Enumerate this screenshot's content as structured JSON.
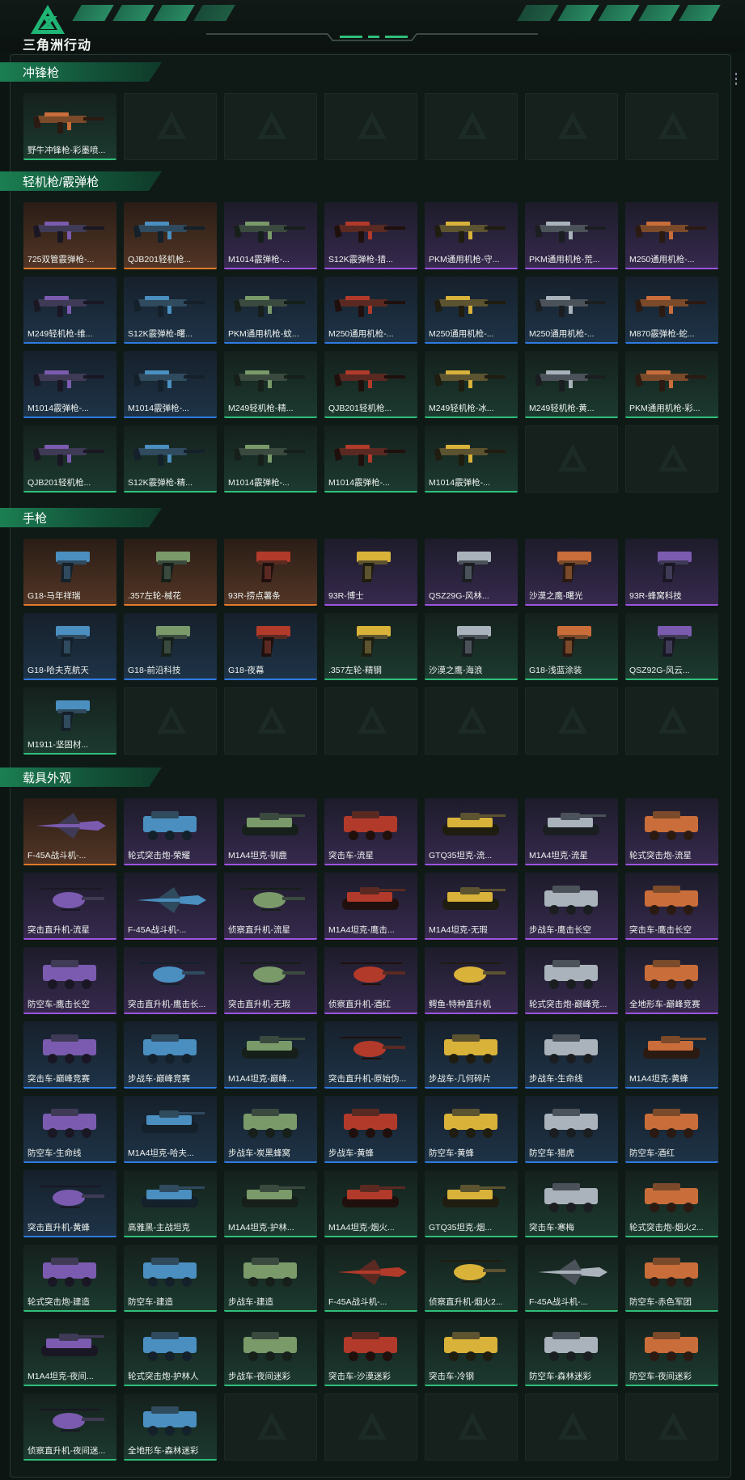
{
  "app": {
    "title": "三角洲行动"
  },
  "colors": {
    "orange": "#e27a2a",
    "purple": "#9c54e0",
    "blue": "#2f7ae0",
    "green": "#2fbf7a",
    "accent": "#1b7f52"
  },
  "sections": [
    {
      "title": "冲锋枪",
      "icon": "gun-icon",
      "slots": 7,
      "items": [
        {
          "name": "野牛冲锋枪-彩墨喷...",
          "rarity": "green"
        }
      ]
    },
    {
      "title": "轻机枪/霰弹枪",
      "icon": "gun-icon",
      "slots": 28,
      "items": [
        {
          "name": "725双管霰弹枪-...",
          "rarity": "orange"
        },
        {
          "name": "QJB201轻机枪...",
          "rarity": "orange"
        },
        {
          "name": "M1014霰弹枪-...",
          "rarity": "purple"
        },
        {
          "name": "S12K霰弹枪-猎...",
          "rarity": "purple"
        },
        {
          "name": "PKM通用机枪-守...",
          "rarity": "purple"
        },
        {
          "name": "PKM通用机枪-荒...",
          "rarity": "purple"
        },
        {
          "name": "M250通用机枪-...",
          "rarity": "purple"
        },
        {
          "name": "M249轻机枪-维...",
          "rarity": "blue"
        },
        {
          "name": "S12K霰弹枪-曙...",
          "rarity": "blue"
        },
        {
          "name": "PKM通用机枪-蚊...",
          "rarity": "blue"
        },
        {
          "name": "M250通用机枪-...",
          "rarity": "blue"
        },
        {
          "name": "M250通用机枪-...",
          "rarity": "blue"
        },
        {
          "name": "M250通用机枪-...",
          "rarity": "blue"
        },
        {
          "name": "M870霰弹枪-蛇...",
          "rarity": "blue"
        },
        {
          "name": "M1014霰弹枪-...",
          "rarity": "blue"
        },
        {
          "name": "M1014霰弹枪-...",
          "rarity": "blue"
        },
        {
          "name": "M249轻机枪-精...",
          "rarity": "green"
        },
        {
          "name": "QJB201轻机枪...",
          "rarity": "green"
        },
        {
          "name": "M249轻机枪-冰...",
          "rarity": "green"
        },
        {
          "name": "M249轻机枪-黄...",
          "rarity": "green"
        },
        {
          "name": "PKM通用机枪-彩...",
          "rarity": "green"
        },
        {
          "name": "QJB201轻机枪...",
          "rarity": "green"
        },
        {
          "name": "S12K霰弹枪-精...",
          "rarity": "green"
        },
        {
          "name": "M1014霰弹枪-...",
          "rarity": "green"
        },
        {
          "name": "M1014霰弹枪-...",
          "rarity": "green"
        },
        {
          "name": "M1014霰弹枪-...",
          "rarity": "green"
        }
      ]
    },
    {
      "title": "手枪",
      "icon": "pistol-icon",
      "slots": 21,
      "items": [
        {
          "name": "G18-马年祥瑞",
          "rarity": "orange"
        },
        {
          "name": ".357左轮-械花",
          "rarity": "orange"
        },
        {
          "name": "93R-捞点薯条",
          "rarity": "orange"
        },
        {
          "name": "93R-博士",
          "rarity": "purple"
        },
        {
          "name": "QSZ29G-风林...",
          "rarity": "purple"
        },
        {
          "name": "沙漠之鹰-曙光",
          "rarity": "purple"
        },
        {
          "name": "93R-蜂窝科技",
          "rarity": "purple"
        },
        {
          "name": "G18-哈夫克航天",
          "rarity": "blue"
        },
        {
          "name": "G18-前沿科技",
          "rarity": "blue"
        },
        {
          "name": "G18-夜幕",
          "rarity": "blue"
        },
        {
          "name": ".357左轮-精钢",
          "rarity": "green"
        },
        {
          "name": "沙漠之鹰-海浪",
          "rarity": "green"
        },
        {
          "name": "G18-浅蓝涂装",
          "rarity": "green"
        },
        {
          "name": "QSZ92G-风云...",
          "rarity": "green"
        },
        {
          "name": "M1911-坚固材...",
          "rarity": "green"
        }
      ]
    },
    {
      "title": "载具外观",
      "icon": "vehicle-icon",
      "slots": 63,
      "items": [
        {
          "name": "F-45A战斗机-...",
          "rarity": "orange"
        },
        {
          "name": "轮式突击炮-荣耀",
          "rarity": "purple"
        },
        {
          "name": "M1A4坦克-驯鹿",
          "rarity": "purple"
        },
        {
          "name": "突击车-流星",
          "rarity": "purple"
        },
        {
          "name": "GTQ35坦克-流...",
          "rarity": "purple"
        },
        {
          "name": "M1A4坦克-流星",
          "rarity": "purple"
        },
        {
          "name": "轮式突击炮-流星",
          "rarity": "purple"
        },
        {
          "name": "突击直升机-流星",
          "rarity": "purple"
        },
        {
          "name": "F-45A战斗机-...",
          "rarity": "purple"
        },
        {
          "name": "侦察直升机-流星",
          "rarity": "purple"
        },
        {
          "name": "M1A4坦克-鹰击...",
          "rarity": "purple"
        },
        {
          "name": "M1A4坦克-无瑕",
          "rarity": "purple"
        },
        {
          "name": "步战车-鹰击长空",
          "rarity": "purple"
        },
        {
          "name": "突击车-鹰击长空",
          "rarity": "purple"
        },
        {
          "name": "防空车-鹰击长空",
          "rarity": "purple"
        },
        {
          "name": "突击直升机-鹰击长...",
          "rarity": "purple"
        },
        {
          "name": "突击直升机-无瑕",
          "rarity": "purple"
        },
        {
          "name": "侦察直升机-酒红",
          "rarity": "purple"
        },
        {
          "name": "鳄鱼-特种直升机",
          "rarity": "purple"
        },
        {
          "name": "轮式突击炮-巅峰竞...",
          "rarity": "purple"
        },
        {
          "name": "全地形车-巅峰竞赛",
          "rarity": "purple"
        },
        {
          "name": "突击车-巅峰竞赛",
          "rarity": "blue"
        },
        {
          "name": "步战车-巅峰竞赛",
          "rarity": "blue"
        },
        {
          "name": "M1A4坦克-巅峰...",
          "rarity": "blue"
        },
        {
          "name": "突击直升机-原始伪...",
          "rarity": "blue"
        },
        {
          "name": "步战车-几何碎片",
          "rarity": "blue"
        },
        {
          "name": "步战车-生命线",
          "rarity": "blue"
        },
        {
          "name": "M1A4坦克-黄蜂",
          "rarity": "blue"
        },
        {
          "name": "防空车-生命线",
          "rarity": "blue"
        },
        {
          "name": "M1A4坦克-哈夫...",
          "rarity": "blue"
        },
        {
          "name": "步战车-炭黑蜂窝",
          "rarity": "blue"
        },
        {
          "name": "步战车-黄蜂",
          "rarity": "blue"
        },
        {
          "name": "防空车-黄蜂",
          "rarity": "blue"
        },
        {
          "name": "防空车-猎虎",
          "rarity": "blue"
        },
        {
          "name": "防空车-酒红",
          "rarity": "blue"
        },
        {
          "name": "突击直升机-黄蜂",
          "rarity": "blue"
        },
        {
          "name": "高雅黑-主战坦克",
          "rarity": "green"
        },
        {
          "name": "M1A4坦克-护林...",
          "rarity": "green"
        },
        {
          "name": "M1A4坦克-烟火...",
          "rarity": "green"
        },
        {
          "name": "GTQ35坦克-烟...",
          "rarity": "green"
        },
        {
          "name": "突击车-寒梅",
          "rarity": "green"
        },
        {
          "name": "轮式突击炮-烟火2...",
          "rarity": "green"
        },
        {
          "name": "轮式突击炮-建造",
          "rarity": "green"
        },
        {
          "name": "防空车-建造",
          "rarity": "green"
        },
        {
          "name": "步战车-建造",
          "rarity": "green"
        },
        {
          "name": "F-45A战斗机-...",
          "rarity": "green"
        },
        {
          "name": "侦察直升机-烟火2...",
          "rarity": "green"
        },
        {
          "name": "F-45A战斗机-...",
          "rarity": "green"
        },
        {
          "name": "防空车-赤色军团",
          "rarity": "green"
        },
        {
          "name": "M1A4坦克-夜间...",
          "rarity": "green"
        },
        {
          "name": "轮式突击炮-护林人",
          "rarity": "green"
        },
        {
          "name": "步战车-夜间迷彩",
          "rarity": "green"
        },
        {
          "name": "突击车-沙漠迷彩",
          "rarity": "green"
        },
        {
          "name": "突击车-冷钢",
          "rarity": "green"
        },
        {
          "name": "防空车-森林迷彩",
          "rarity": "green"
        },
        {
          "name": "防空车-夜间迷彩",
          "rarity": "green"
        },
        {
          "name": "侦察直升机-夜间迷...",
          "rarity": "green"
        },
        {
          "name": "全地形车-森林迷彩",
          "rarity": "green"
        }
      ]
    }
  ]
}
